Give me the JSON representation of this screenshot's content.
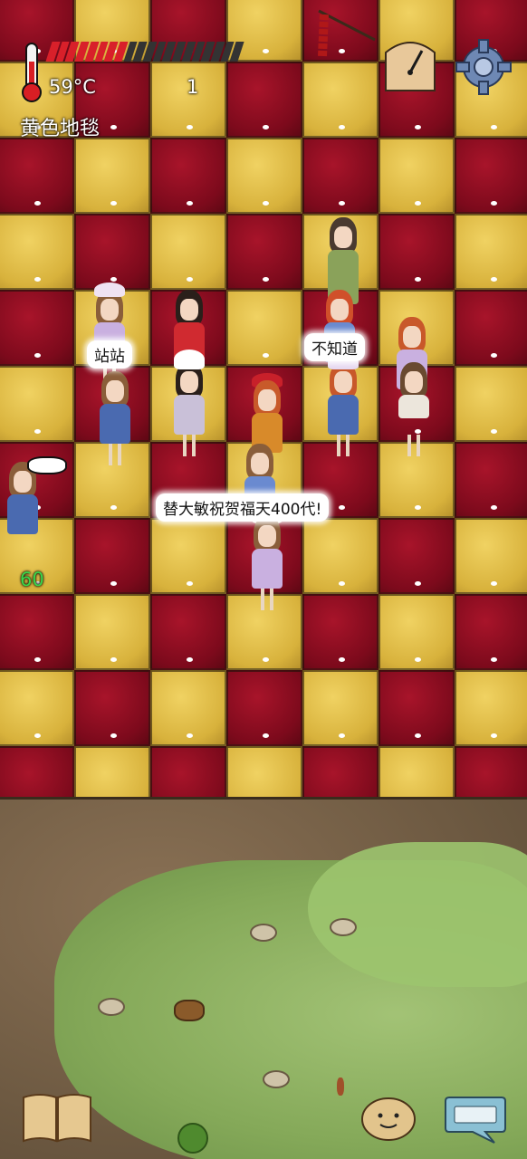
{
  "hud": {
    "temperature": "59°C",
    "age_counter": "1",
    "location_label": "黄色地毯",
    "food_level": 0.4,
    "food_segments": 20,
    "food_color_full": "#d8202a",
    "food_color_empty": "#333333"
  },
  "speech": {
    "bubble_1": "站站",
    "bubble_2": "不知道",
    "bubble_3": "替大敏祝贺福天400代!"
  },
  "indicator": {
    "count": "60",
    "color": "#39d64a"
  },
  "colors": {
    "carpet_red": "#8e0f22",
    "carpet_yellow": "#dcb640",
    "dirt": "#6e5a42",
    "grass": "#8fb862"
  },
  "icons": {
    "thermometer": "thermometer-icon",
    "compass": "compass-icon",
    "settings": "gear-icon",
    "book": "book-icon",
    "emote": "emote-face-icon",
    "keyboard": "keyboard-icon",
    "firecracker": "firecracker-icon"
  }
}
